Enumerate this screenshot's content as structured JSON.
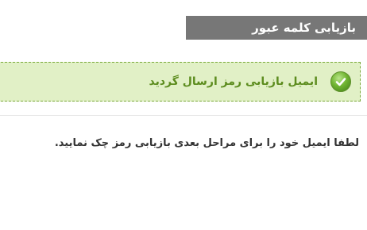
{
  "header": {
    "title": "بازیابی کلمه عبور"
  },
  "alert": {
    "type": "success",
    "icon": "checkmark-icon",
    "message": "ایمیل بازیابی رمز ارسال گردید",
    "colors": {
      "background": "#e1f0c6",
      "border": "#7aa93a",
      "text": "#5c8c1e"
    }
  },
  "body": {
    "instruction": "لطفا ایمیل خود را برای مراحل بعدی بازیابی رمز چک نمایید."
  }
}
